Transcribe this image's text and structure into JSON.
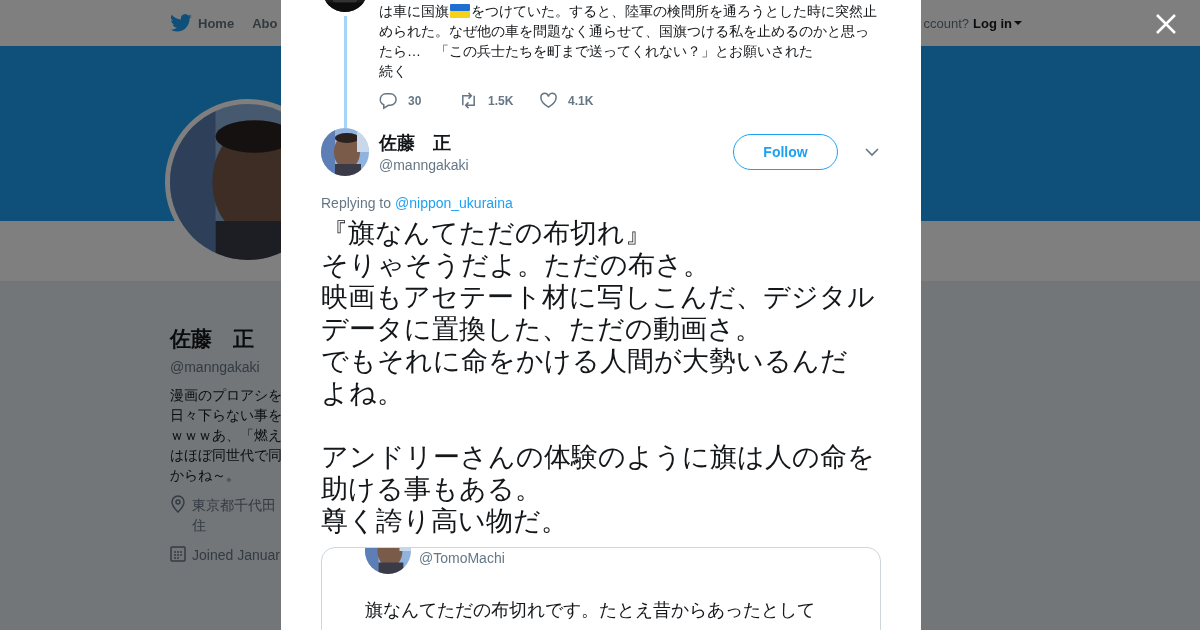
{
  "nav": {
    "home": "Home",
    "about": "Abo",
    "account": "ccount?",
    "login": "Log in"
  },
  "profile": {
    "name": "佐藤　正",
    "handle": "@manngakaki",
    "bio_lines": [
      "漫画のプロアシを",
      "日々下らない事を",
      "ｗｗｗあ、「燃え",
      "はほぼ同世代で同",
      "からね～。"
    ],
    "location_lines": [
      "東京都千代田",
      "住"
    ],
    "joined": "Joined Januar"
  },
  "previous_tweet": {
    "line1_before": "は車に国旗",
    "line1_after": "をつけていた。すると、陸軍の検問所を通ろうとした時に突然止",
    "lines": [
      "められた。なぜ他の車を問題なく通らせて、国旗つける私を止めるのかと思っ",
      "たら…　「この兵士たちを町まで送ってくれない？」とお願いされた"
    ],
    "more": "続く",
    "replies": "30",
    "retweets": "1.5K",
    "likes": "4.1K"
  },
  "tweet": {
    "name": "佐藤　正",
    "handle": "@manngakaki",
    "follow": "Follow",
    "replying_label": "Replying to",
    "replying_to": "@nippon_ukuraina",
    "paragraphs": [
      [
        "『旗なんてただの布切れ』",
        "そりゃそうだよ。ただの布さ。",
        "映画もアセテート材に写しこんだ、デジタル",
        "データに置換した、ただの動画さ。",
        "でもそれに命をかける人間が大勢いるんだ",
        "よね。"
      ],
      [
        "アンドリーさんの体験のように旗は人の命を",
        "助ける事もある。",
        "尊く誇り高い物だ。"
      ]
    ]
  },
  "quoted_tweet": {
    "handle": "@TomoMachi",
    "text": "旗なんてただの布切れです。たとえ昔からあったとして"
  }
}
